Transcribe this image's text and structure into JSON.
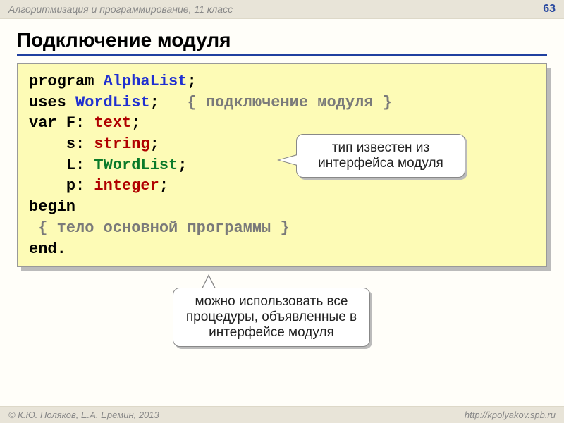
{
  "header": {
    "course": "Алгоритмизация и программирование, 11 класс",
    "page": "63"
  },
  "title": "Подключение модуля",
  "code": {
    "l1": {
      "kw": "program ",
      "id": "AlphaList",
      "tail": ";"
    },
    "l2": {
      "kw": "uses ",
      "id": "WordList",
      "tail": ";   ",
      "comment": "{ подключение модуля }"
    },
    "l3": {
      "kw": "var ",
      "v": "F: ",
      "type": "text",
      "tail": ";"
    },
    "l4": {
      "pad": "    ",
      "v": "s: ",
      "type": "string",
      "tail": ";"
    },
    "l5": {
      "pad": "    ",
      "v": "L: ",
      "type": "TWordList",
      "tail": ";"
    },
    "l6": {
      "pad": "    ",
      "v": "p: ",
      "type": "integer",
      "tail": ";"
    },
    "l7": {
      "kw": "begin"
    },
    "l8": {
      "pad": " ",
      "comment": "{ тело основной программы }"
    },
    "l9": {
      "kw": "end."
    }
  },
  "callouts": {
    "c1": "тип известен из интерфейса модуля",
    "c2": "можно использовать все процедуры, объявленные в интерфейсе модуля"
  },
  "footer": {
    "left": "© К.Ю. Поляков, Е.А. Ерёмин, 2013",
    "right": "http://kpolyakov.spb.ru"
  }
}
